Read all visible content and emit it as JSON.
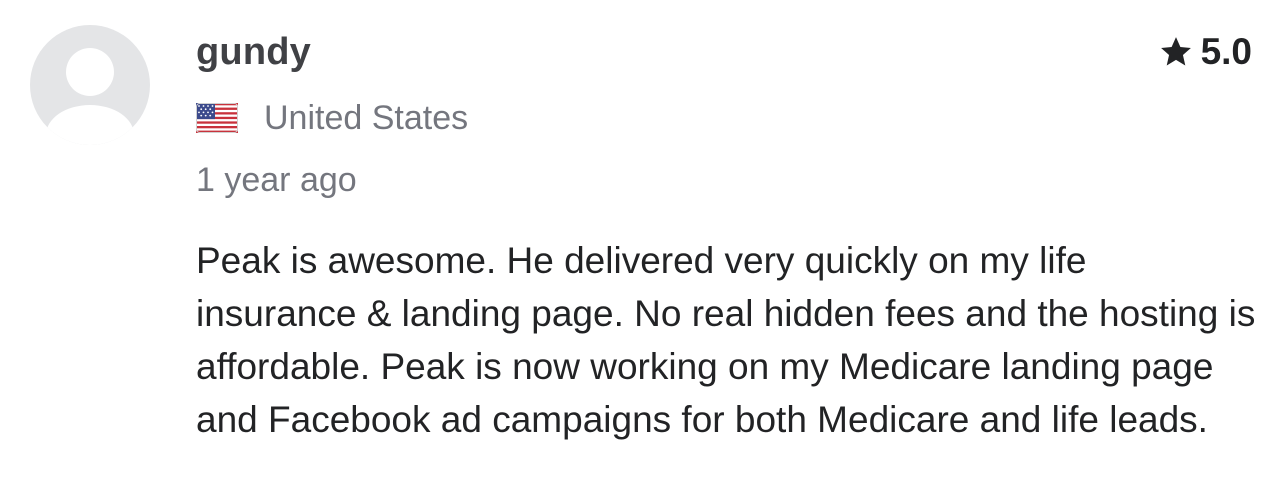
{
  "review": {
    "username": "gundy",
    "avatar_icon": "default-user-avatar-icon",
    "rating": "5.0",
    "rating_icon": "star-icon",
    "country": "United States",
    "country_flag_icon": "us-flag-icon",
    "time_ago": "1 year ago",
    "text": "Peak is awesome. He delivered very quickly on my life insurance & landing page. No real hidden fees and the hosting is affordable. Peak is now working on my Medicare landing page and Facebook ad campaigns for both Medicare and life leads."
  },
  "colors": {
    "avatar_bg": "#e4e5e7",
    "avatar_silhouette": "#ffffff",
    "username": "#404145",
    "body_text": "#222325",
    "muted_text": "#74767e"
  }
}
